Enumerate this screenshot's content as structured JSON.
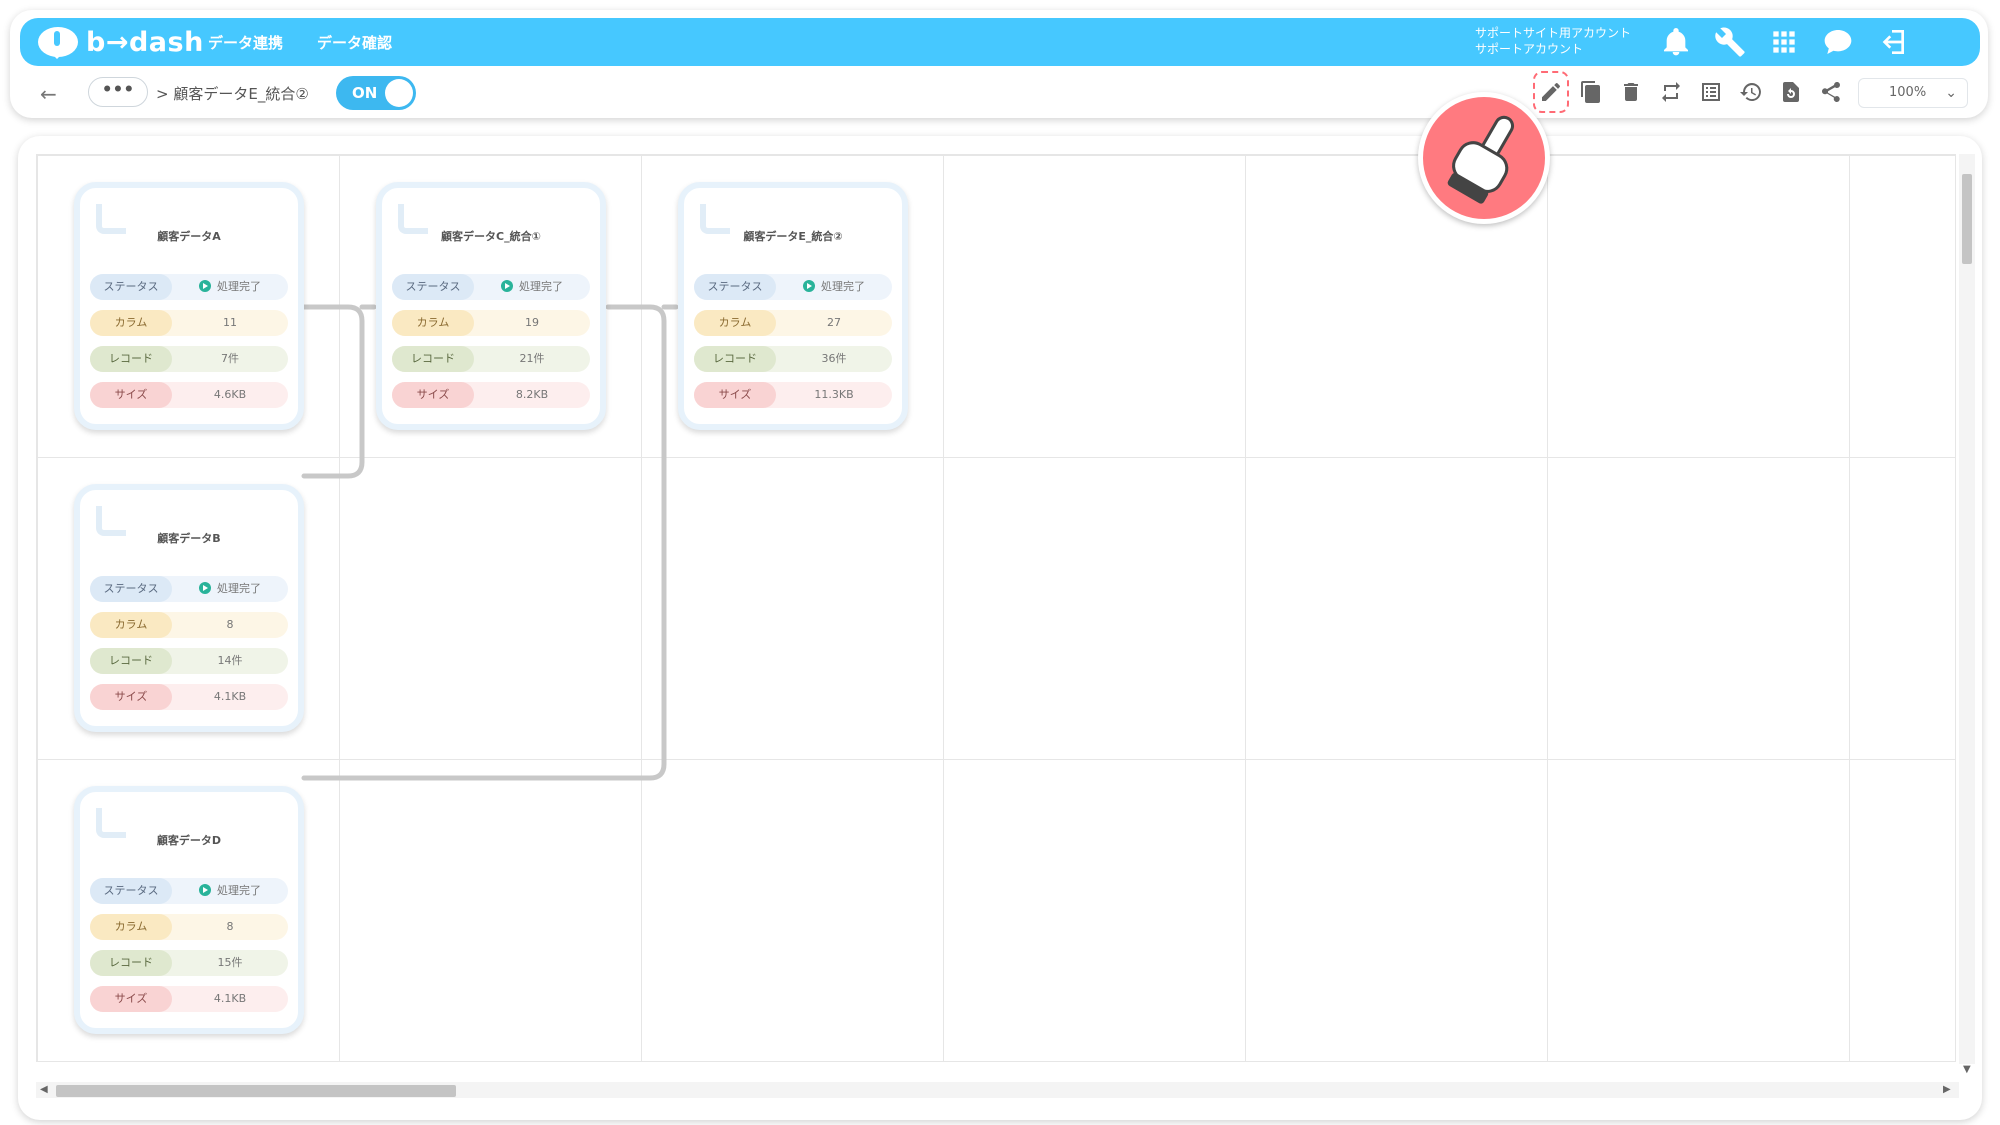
{
  "app": {
    "logo_text": "b→dash",
    "nav": [
      "データ連携",
      "データ確認"
    ],
    "account_line1": "サポートサイト用アカウント",
    "account_line2": "サポートアカウント"
  },
  "top_icons": [
    "bell-icon",
    "wrench-icon",
    "apps-grid-icon",
    "chat-icon",
    "logout-icon"
  ],
  "breadcrumb": {
    "back": "←",
    "more": "•••",
    "current": "> 顧客データE_統合②"
  },
  "toggle": {
    "label": "ON"
  },
  "toolbar": {
    "icons": [
      "edit-icon",
      "copy-icon",
      "delete-icon",
      "swap-icon",
      "list-icon",
      "history-icon",
      "restore-icon",
      "share-icon"
    ],
    "zoom": "100%",
    "zoom_caret": "⌄"
  },
  "labels": {
    "status": "ステータス",
    "column": "カラム",
    "record": "レコード",
    "size": "サイズ"
  },
  "nodes": [
    {
      "title": "顧客データA",
      "status": "処理完了",
      "columns": "11",
      "records": "7件",
      "size": "4.6KB"
    },
    {
      "title": "顧客データC_統合①",
      "status": "処理完了",
      "columns": "19",
      "records": "21件",
      "size": "8.2KB"
    },
    {
      "title": "顧客データE_統合②",
      "status": "処理完了",
      "columns": "27",
      "records": "36件",
      "size": "11.3KB"
    },
    {
      "title": "顧客データB",
      "status": "処理完了",
      "columns": "8",
      "records": "14件",
      "size": "4.1KB"
    },
    {
      "title": "顧客データD",
      "status": "処理完了",
      "columns": "8",
      "records": "15件",
      "size": "4.1KB"
    }
  ],
  "colors": {
    "brand": "#46c8ff",
    "toggle": "#3db8f0",
    "highlight": "#ff7a80",
    "status_ok": "#29b39a"
  }
}
